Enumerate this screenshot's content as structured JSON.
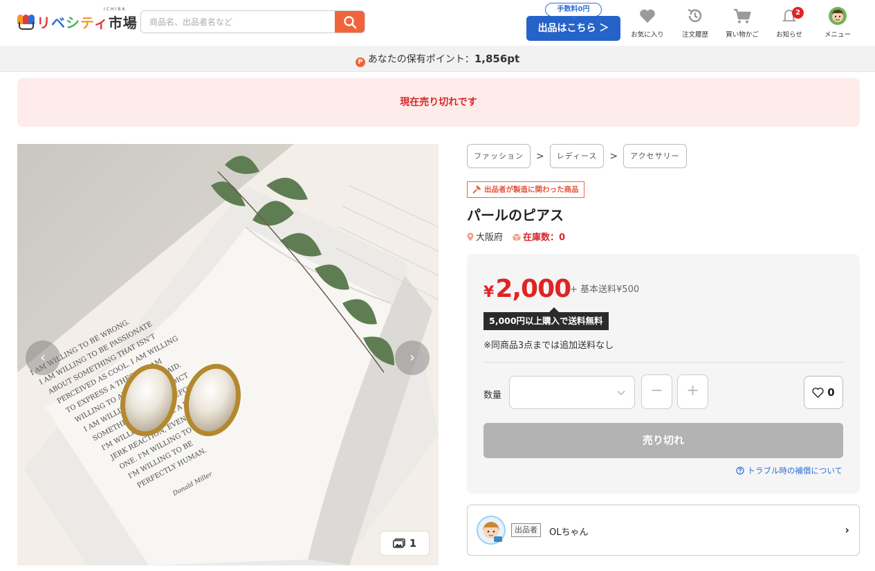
{
  "header": {
    "logo_text": "リベシティ市場",
    "logo_sub": "ICHIBA",
    "search_placeholder": "商品名、出品者名など",
    "fee_badge": "手数料0円",
    "sell_button": "出品はこちら ＞",
    "nav": [
      {
        "label": "お気に入り",
        "icon": "heart-icon"
      },
      {
        "label": "注文履歴",
        "icon": "history-icon"
      },
      {
        "label": "買い物かご",
        "icon": "cart-icon"
      },
      {
        "label": "お知らせ",
        "icon": "bell-icon",
        "badge": "2"
      },
      {
        "label": "メニュー",
        "icon": "avatar-icon"
      }
    ]
  },
  "points": {
    "icon": "P",
    "label": "あなたの保有ポイント：",
    "value": "1,856pt"
  },
  "banner": {
    "text": "現在売り切れです"
  },
  "gallery": {
    "count": "1",
    "prev": "‹",
    "next": "›"
  },
  "product": {
    "breadcrumb": [
      "ファッション",
      "レディース",
      "アクセサリー"
    ],
    "maker_tag": "出品者が製造に関わった商品",
    "title": "パールのピアス",
    "location": "大阪府",
    "stock": "在庫数：0",
    "price_yen": "¥",
    "price": "2,000",
    "shipping": "+ 基本送料¥500",
    "free_shipping": "5,000円以上購入で送料無料",
    "note": "※同商品3点までは追加送料なし",
    "qty_label": "数量",
    "minus": "−",
    "plus": "+",
    "fav_count": "0",
    "soldout_button": "売り切れ",
    "guarantee_link": "トラブル時の補償について"
  },
  "seller": {
    "tag": "出品者",
    "name": "OLちゃん",
    "chevron": "›"
  },
  "colors": {
    "accent": "#f0643a",
    "brand_blue": "#2563c9",
    "price_red": "#e02424",
    "banner_bg": "#fdecea"
  }
}
